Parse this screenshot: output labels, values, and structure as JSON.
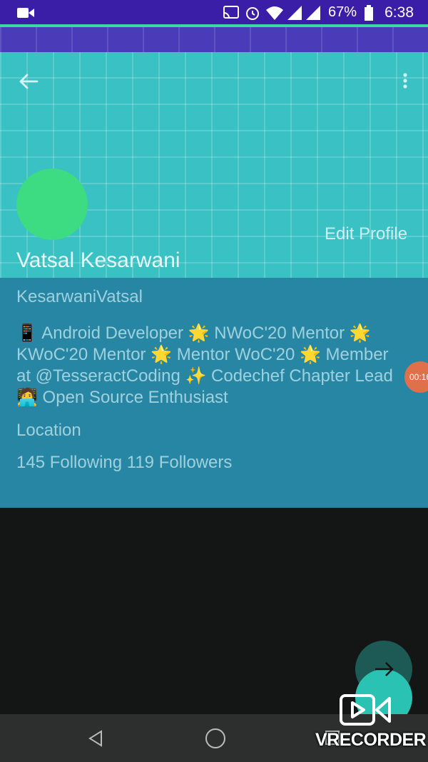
{
  "status_bar": {
    "time": "6:38",
    "battery_percent": "67%",
    "icons": [
      "video-camera-icon",
      "cast-icon",
      "alarm-icon",
      "wifi-icon",
      "signal-icon",
      "battery-icon"
    ]
  },
  "toolbar": {
    "back_icon": "arrow-back-icon",
    "menu_icon": "more-vert-icon"
  },
  "profile": {
    "name": "Vatsal Kesarwani",
    "edit_label": "Edit Profile",
    "username": "KesarwaniVatsal",
    "bio_lines": [
      "📱 Android Developer 🌟 NWoC'20 Mentor 🌟",
      "KWoC'20 Mentor 🌟 Mentor WoC'20 🌟 Member",
      "at @TesseractCoding ✨ Codechef Chapter Lead",
      "🧑‍💻 Open Source Enthusiast"
    ],
    "location": "Location",
    "follow_counts": "145 Following 119 Followers"
  },
  "overlay": {
    "timer": "00:16",
    "recorder_label": "VRECORDER"
  },
  "fab": {
    "icon": "arrow-forward-icon"
  },
  "nav": {
    "icons": [
      "nav-back-icon",
      "nav-home-icon",
      "nav-recents-icon"
    ]
  },
  "colors": {
    "header_bg": "#39c1c4",
    "info_bg": "#2786a4",
    "avatar": "#3ddb82",
    "status_bar": "#3a1ea8",
    "fab": "#29c2b3"
  }
}
